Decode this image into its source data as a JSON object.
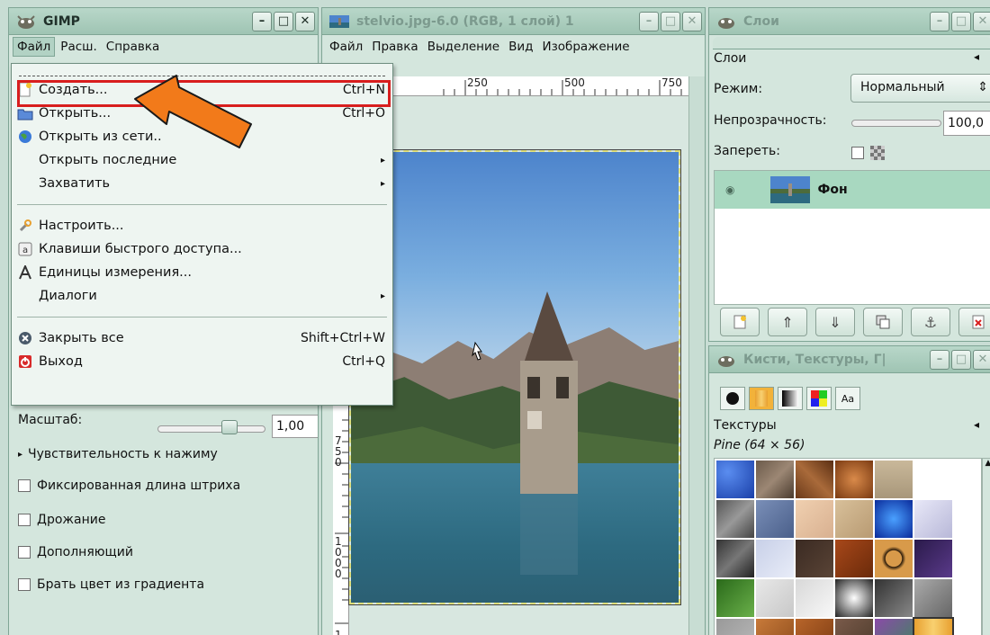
{
  "toolbox": {
    "title": "GIMP",
    "menubar": [
      "Файл",
      "Расш.",
      "Справка"
    ],
    "options": {
      "scale_label": "Масштаб:",
      "scale_value": "1,00",
      "pressure_label": "Чувствительность к нажиму",
      "checkboxes": [
        "Фиксированная длина штриха",
        "Дрожание",
        "Дополняющий",
        "Брать цвет из градиента"
      ]
    }
  },
  "file_menu": {
    "items": [
      {
        "label": "Создать...",
        "shortcut": "Ctrl+N",
        "icon": "new-document-icon",
        "highlighted": true
      },
      {
        "label": "Открыть...",
        "shortcut": "Ctrl+O",
        "icon": "open-folder-icon"
      },
      {
        "label": "Открыть из сети..",
        "shortcut": "",
        "icon": "globe-icon"
      },
      {
        "label": "Открыть последние",
        "shortcut": "",
        "submenu": true
      },
      {
        "label": "Захватить",
        "shortcut": "",
        "submenu": true
      },
      {
        "label": "Настроить...",
        "shortcut": "",
        "icon": "wrench-icon"
      },
      {
        "label": "Клавиши быстрого доступа...",
        "shortcut": "",
        "icon": "keyboard-icon"
      },
      {
        "label": "Единицы измерения...",
        "shortcut": "",
        "icon": "units-icon"
      },
      {
        "label": "Диалоги",
        "shortcut": "",
        "submenu": true
      },
      {
        "label": "Закрыть все",
        "shortcut": "Shift+Ctrl+W",
        "icon": "close-all-icon"
      },
      {
        "label": "Выход",
        "shortcut": "Ctrl+Q",
        "icon": "quit-icon"
      }
    ]
  },
  "image_window": {
    "title": "stelvio.jpg-6.0 (RGB, 1 слой) 1",
    "menubar": [
      "Файл",
      "Правка",
      "Выделение",
      "Вид",
      "Изображение"
    ],
    "ruler_top": [
      "250",
      "500",
      "750"
    ],
    "ruler_left": [
      "7",
      "5",
      "0",
      "1",
      "0",
      "0",
      "0",
      "1"
    ]
  },
  "layers_dock": {
    "title": "Слои",
    "tab_label": "Слои",
    "mode_label": "Режим:",
    "mode_value": "Нормальный",
    "opacity_label": "Непрозрачность:",
    "opacity_value": "100,0",
    "lock_label": "Запереть:",
    "layer_name": "Фон"
  },
  "brushes_dock": {
    "title": "Кисти, Текстуры, Г|",
    "tab_text": "Aa",
    "section_label": "Текстуры",
    "selected_pattern": "Pine (64 × 56)"
  },
  "colors": {
    "highlight": "#d81e1e",
    "arrow": "#f27a1a",
    "panel": "#d4e6dd",
    "layer_selected": "#a8d8c0"
  }
}
